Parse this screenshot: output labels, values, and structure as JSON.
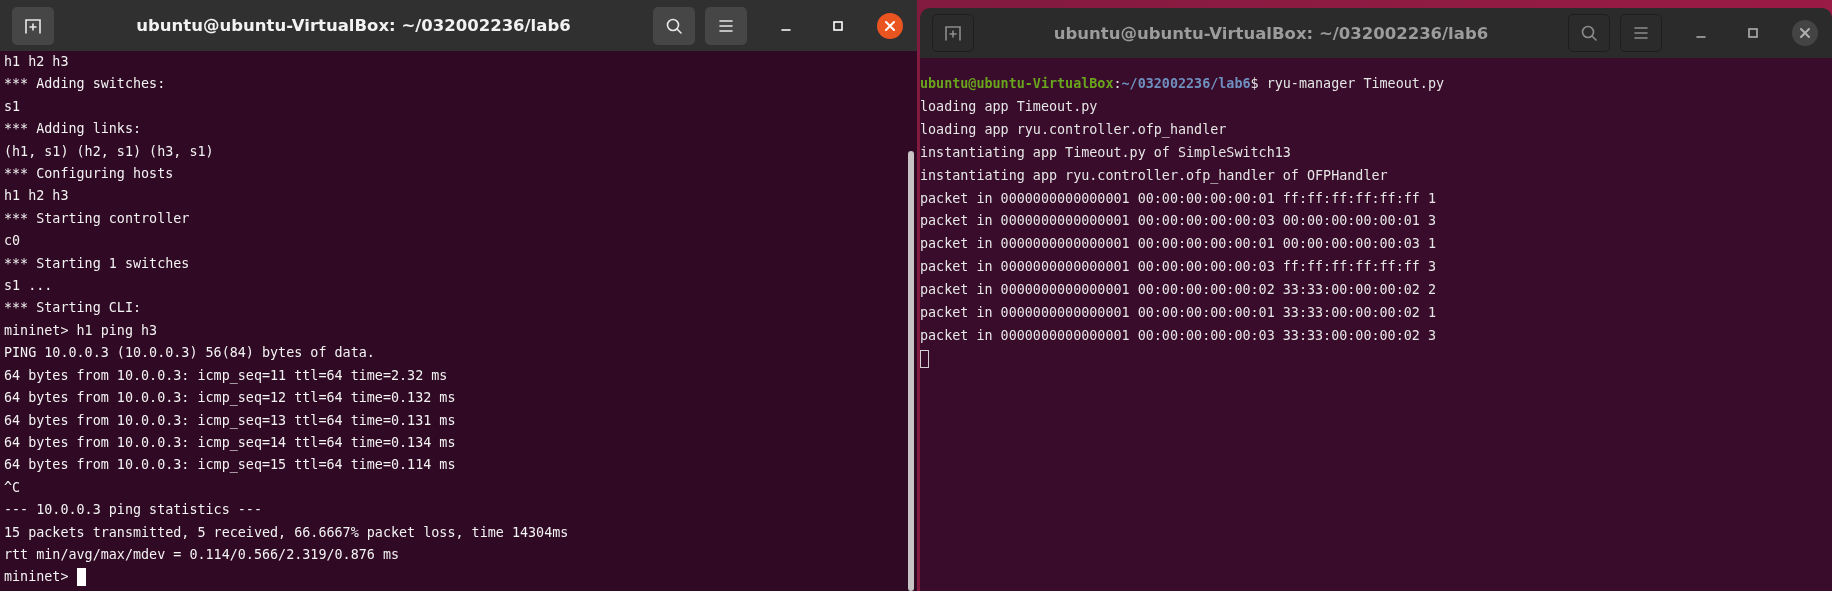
{
  "windows": [
    {
      "title": "ubuntu@ubuntu-VirtualBox: ~/032002236/lab6",
      "focused": true,
      "scrollbar": true,
      "lines": [
        {
          "kind": "text",
          "text": "h1 h2 h3"
        },
        {
          "kind": "text",
          "text": "*** Adding switches:"
        },
        {
          "kind": "text",
          "text": "s1"
        },
        {
          "kind": "text",
          "text": "*** Adding links:"
        },
        {
          "kind": "text",
          "text": "(h1, s1) (h2, s1) (h3, s1)"
        },
        {
          "kind": "text",
          "text": "*** Configuring hosts"
        },
        {
          "kind": "text",
          "text": "h1 h2 h3"
        },
        {
          "kind": "text",
          "text": "*** Starting controller"
        },
        {
          "kind": "text",
          "text": "c0"
        },
        {
          "kind": "text",
          "text": "*** Starting 1 switches"
        },
        {
          "kind": "text",
          "text": "s1 ..."
        },
        {
          "kind": "text",
          "text": "*** Starting CLI:"
        },
        {
          "kind": "text",
          "text": "mininet> h1 ping h3"
        },
        {
          "kind": "text",
          "text": "PING 10.0.0.3 (10.0.0.3) 56(84) bytes of data."
        },
        {
          "kind": "text",
          "text": "64 bytes from 10.0.0.3: icmp_seq=11 ttl=64 time=2.32 ms"
        },
        {
          "kind": "text",
          "text": "64 bytes from 10.0.0.3: icmp_seq=12 ttl=64 time=0.132 ms"
        },
        {
          "kind": "text",
          "text": "64 bytes from 10.0.0.3: icmp_seq=13 ttl=64 time=0.131 ms"
        },
        {
          "kind": "text",
          "text": "64 bytes from 10.0.0.3: icmp_seq=14 ttl=64 time=0.134 ms"
        },
        {
          "kind": "text",
          "text": "64 bytes from 10.0.0.3: icmp_seq=15 ttl=64 time=0.114 ms"
        },
        {
          "kind": "text",
          "text": "^C"
        },
        {
          "kind": "text",
          "text": "--- 10.0.0.3 ping statistics ---"
        },
        {
          "kind": "text",
          "text": "15 packets transmitted, 5 received, 66.6667% packet loss, time 14304ms"
        },
        {
          "kind": "text",
          "text": "rtt min/avg/max/mdev = 0.114/0.566/2.319/0.876 ms"
        }
      ],
      "input_prompt": "mininet>"
    },
    {
      "title": "ubuntu@ubuntu-VirtualBox: ~/032002236/lab6",
      "focused": false,
      "lines": [
        {
          "kind": "prompt",
          "user": "ubuntu@ubuntu-VirtualBox",
          "sep": ":",
          "path": "~/032002236/lab6",
          "command": "$ ryu-manager Timeout.py"
        },
        {
          "kind": "text",
          "text": "loading app Timeout.py"
        },
        {
          "kind": "text",
          "text": "loading app ryu.controller.ofp_handler"
        },
        {
          "kind": "text",
          "text": "instantiating app Timeout.py of SimpleSwitch13"
        },
        {
          "kind": "text",
          "text": "instantiating app ryu.controller.ofp_handler of OFPHandler"
        },
        {
          "kind": "text",
          "text": "packet in 0000000000000001 00:00:00:00:00:01 ff:ff:ff:ff:ff:ff 1"
        },
        {
          "kind": "text",
          "text": "packet in 0000000000000001 00:00:00:00:00:03 00:00:00:00:00:01 3"
        },
        {
          "kind": "text",
          "text": "packet in 0000000000000001 00:00:00:00:00:01 00:00:00:00:00:03 1"
        },
        {
          "kind": "text",
          "text": "packet in 0000000000000001 00:00:00:00:00:03 ff:ff:ff:ff:ff:ff 3"
        },
        {
          "kind": "text",
          "text": "packet in 0000000000000001 00:00:00:00:00:02 33:33:00:00:00:02 2"
        },
        {
          "kind": "text",
          "text": "packet in 0000000000000001 00:00:00:00:00:01 33:33:00:00:00:02 1"
        },
        {
          "kind": "text",
          "text": "packet in 0000000000000001 00:00:00:00:00:03 33:33:00:00:00:02 3"
        }
      ]
    }
  ]
}
